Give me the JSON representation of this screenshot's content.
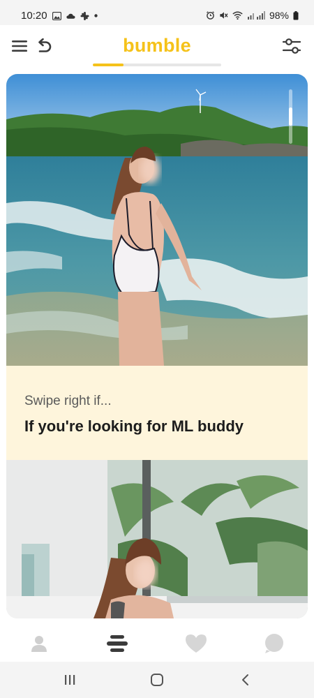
{
  "status_bar": {
    "time": "10:20",
    "battery": "98%",
    "left_icons": [
      "gallery-icon",
      "cloud-icon",
      "slack-icon",
      "dot-icon"
    ],
    "right_icons": [
      "alarm-icon",
      "mute-icon",
      "wifi-icon",
      "signal-icon",
      "battery-icon"
    ]
  },
  "header": {
    "logo": "bumble",
    "left_icons": [
      "menu-icon",
      "undo-icon"
    ],
    "right_icon": "filter-icon",
    "brand_color": "#f5c21a",
    "progress_fraction": 0.24
  },
  "profile": {
    "prompt_label": "Swipe right if...",
    "prompt_answer": "If you're looking for ML buddy",
    "photo_scroll_fraction": 0.33
  },
  "bottom_nav": {
    "items": [
      "profile-icon",
      "discover-icon",
      "likes-icon",
      "chat-icon"
    ],
    "active": "discover-icon"
  },
  "system_nav": {
    "items": [
      "recent-apps-icon",
      "home-icon",
      "back-icon"
    ]
  }
}
